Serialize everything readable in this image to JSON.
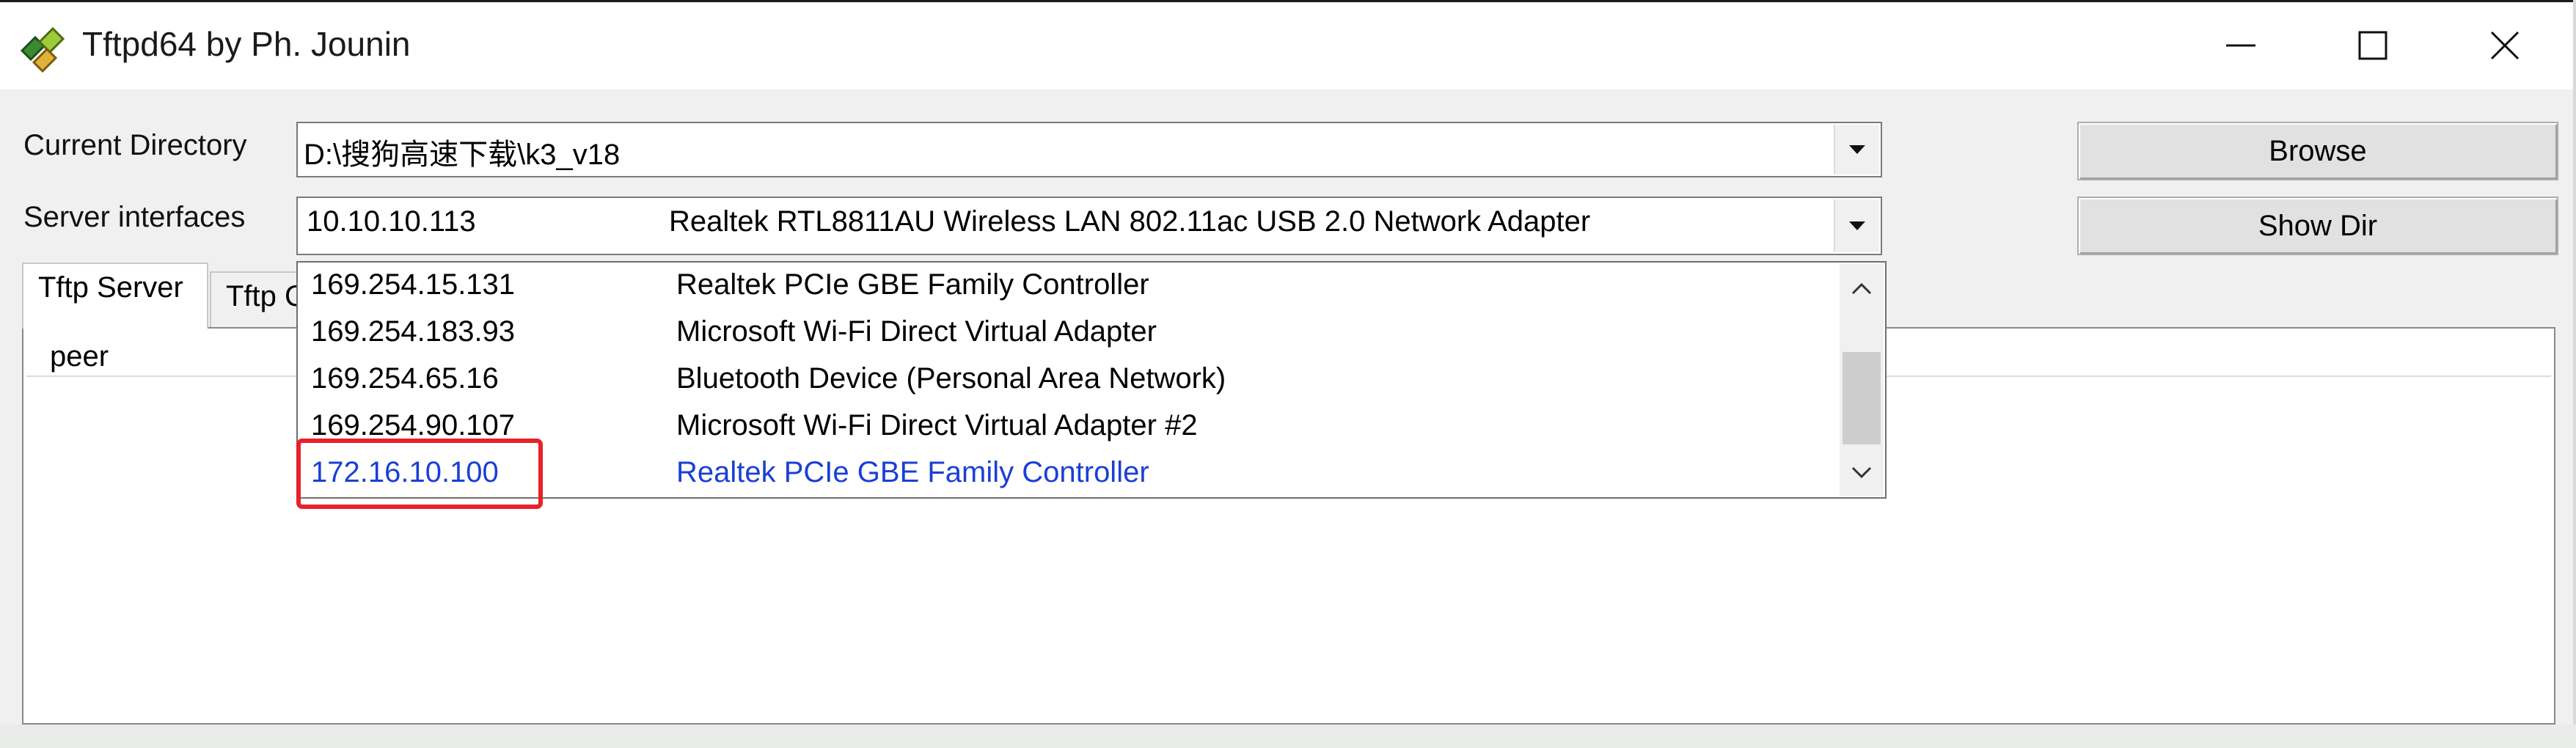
{
  "window": {
    "title": "Tftpd64 by Ph. Jounin",
    "icon": "tftpd-app-icon",
    "controls": [
      "minimize-icon",
      "maximize-icon",
      "close-icon"
    ]
  },
  "current_directory": {
    "label": "Current Directory",
    "value": "D:\\搜狗高速下载\\k3_v18"
  },
  "server_interfaces": {
    "label": "Server interfaces",
    "selected_ip": "10.10.10.113",
    "selected_desc": "Realtek RTL8811AU Wireless LAN 802.11ac USB 2.0 Network Adapter",
    "options": [
      {
        "ip": "169.254.15.131",
        "desc": "Realtek PCIe GBE Family Controller"
      },
      {
        "ip": "169.254.183.93",
        "desc": "Microsoft Wi-Fi Direct Virtual Adapter"
      },
      {
        "ip": "169.254.65.16",
        "desc": "Bluetooth Device (Personal Area Network)"
      },
      {
        "ip": "169.254.90.107",
        "desc": "Microsoft Wi-Fi Direct Virtual Adapter #2"
      },
      {
        "ip": "172.16.10.100",
        "desc": "Realtek PCIe GBE Family Controller",
        "highlighted": true
      }
    ]
  },
  "buttons": {
    "browse": "Browse",
    "show_dir": "Show Dir"
  },
  "tabs": [
    {
      "label": "Tftp Server",
      "active": true
    },
    {
      "label": "Tftp Client",
      "active": false
    }
  ],
  "table": {
    "columns": [
      "peer"
    ]
  },
  "colors": {
    "selected_text": "#1a3fd6",
    "annotation_box": "#e8212a"
  }
}
